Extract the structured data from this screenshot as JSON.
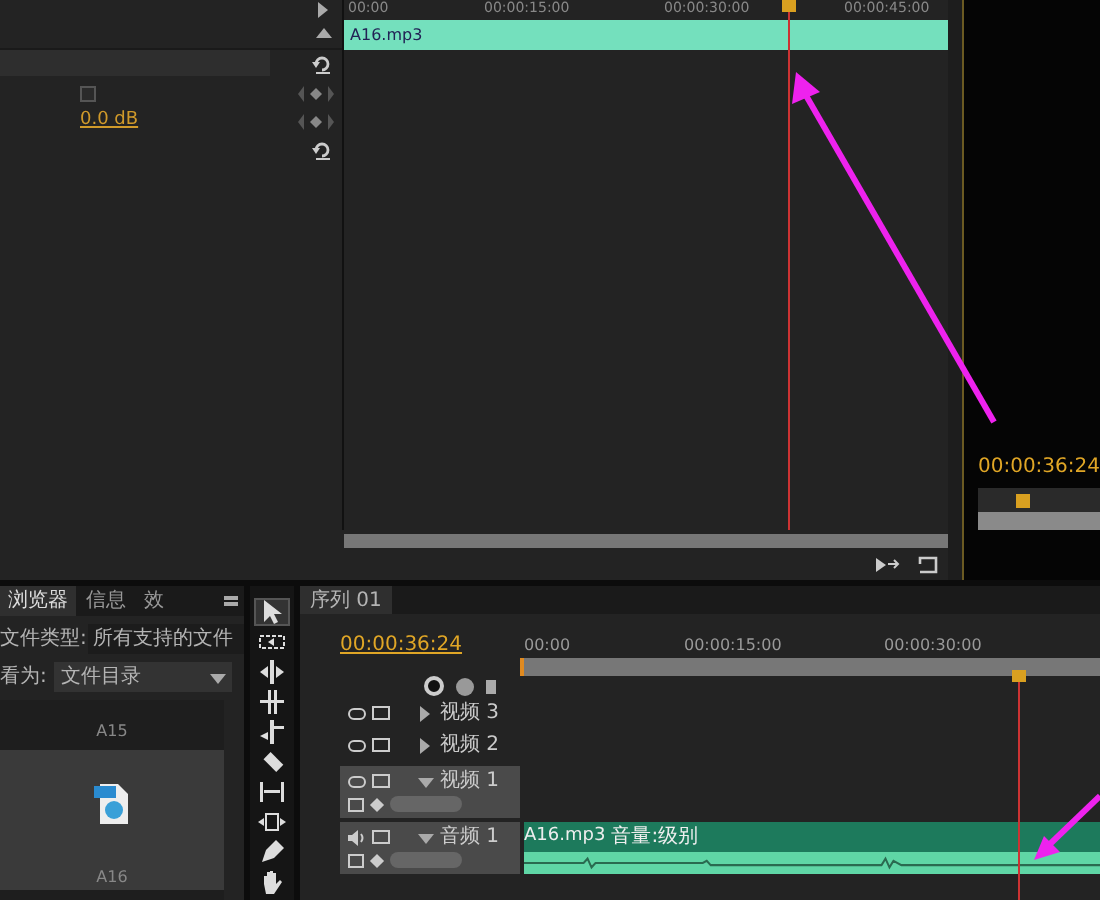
{
  "effect_controls": {
    "bypass": {
      "checked": false
    },
    "level_reading": "0.0 dB"
  },
  "source_timeline": {
    "ruler": [
      "00:00",
      "00:00:15:00",
      "00:00:30:00",
      "00:00:45:00"
    ],
    "clip": "A16.mp3"
  },
  "program_monitor": {
    "timecode": "00:00:36:24"
  },
  "project_panel": {
    "tabs": [
      {
        "label": "浏览器",
        "selected": true
      },
      {
        "label": "信息",
        "selected": false
      },
      {
        "label": "效",
        "selected": false
      }
    ],
    "file_type_label": "文件类型:",
    "file_type_value": "所有支持的文件",
    "view_as_label": "看为:",
    "view_as_value": "文件目录",
    "items": [
      {
        "name": "A15",
        "kind": "label"
      },
      {
        "name": "A16",
        "kind": "audio"
      }
    ]
  },
  "tools": [
    {
      "kind": "select",
      "selected": true
    },
    {
      "kind": "track",
      "selected": false
    },
    {
      "kind": "ripple",
      "selected": false
    },
    {
      "kind": "roll",
      "selected": false
    },
    {
      "kind": "rate",
      "selected": false
    },
    {
      "kind": "razor",
      "selected": false
    },
    {
      "kind": "slip",
      "selected": false
    },
    {
      "kind": "slide",
      "selected": false
    },
    {
      "kind": "pen",
      "selected": false
    },
    {
      "kind": "hand",
      "selected": false
    }
  ],
  "sequence": {
    "tab": "序列 01",
    "timecode": "00:00:36:24",
    "ruler": [
      "00:00",
      "00:00:15:00",
      "00:00:30:00"
    ],
    "tracks": [
      {
        "kind": "video",
        "name": "视频 3",
        "expanded": false
      },
      {
        "kind": "video",
        "name": "视频 2",
        "expanded": false
      },
      {
        "kind": "video",
        "name": "视频 1",
        "expanded": true
      },
      {
        "kind": "audio",
        "name": "音频 1",
        "expanded": true
      }
    ],
    "clip": {
      "name": "A16.mp3",
      "effect": "音量:级别"
    }
  }
}
